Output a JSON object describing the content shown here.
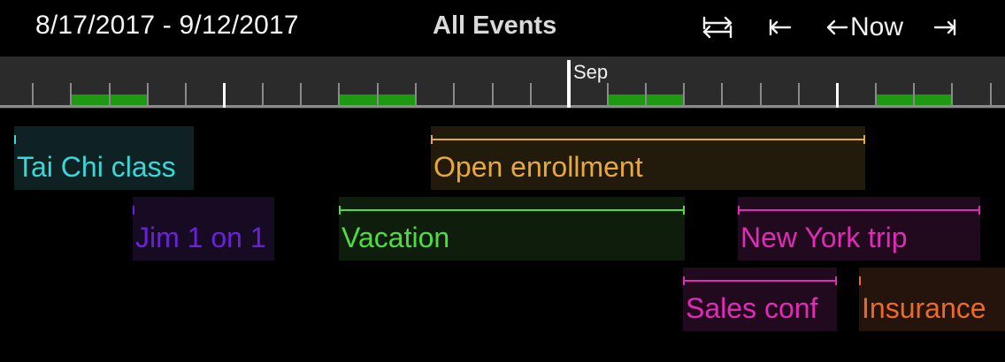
{
  "header": {
    "date_range": "8/17/2017 - 9/12/2017",
    "filter_title": "All Events",
    "now_label": "Now",
    "icons": {
      "swap": "swap-arrows-icon",
      "start": "jump-to-start-icon",
      "now": "left-arrow-icon",
      "end": "jump-to-end-icon"
    }
  },
  "ruler": {
    "month_label": "Sep"
  },
  "events": [
    {
      "name": "Tai Chi class",
      "color": "#37d8d8",
      "bg": "#0e2224"
    },
    {
      "name": "Open enrollment",
      "color": "#e8a93c",
      "bg": "#221a0b"
    },
    {
      "name": "Jim 1 on 1",
      "color": "#6a22d8",
      "bg": "#170b24"
    },
    {
      "name": "Vacation",
      "color": "#4ddc41",
      "bg": "#0e1d0c"
    },
    {
      "name": "New York trip",
      "color": "#e02ab8",
      "bg": "#220a1e"
    },
    {
      "name": "Sales conf",
      "color": "#e02ab8",
      "bg": "#220a1e"
    },
    {
      "name": "Insurance",
      "color": "#ec6a28",
      "bg": "#24140b"
    }
  ]
}
